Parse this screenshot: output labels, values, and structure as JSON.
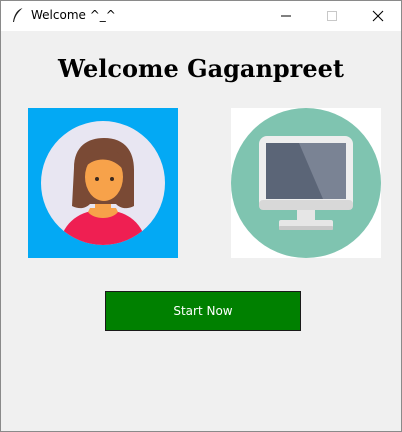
{
  "window": {
    "title": "Welcome ^_^",
    "app_icon": "feather-icon",
    "controls": {
      "minimize_icon": "minimize-icon",
      "maximize_icon": "maximize-icon",
      "close_icon": "close-icon"
    }
  },
  "main": {
    "heading": "Welcome Gaganpreet",
    "images": [
      {
        "icon": "user-avatar-icon",
        "background": "#03a9f4"
      },
      {
        "icon": "computer-monitor-icon",
        "background": "#7fc4b0"
      }
    ],
    "start_button": {
      "label": "Start Now",
      "color": "#008000"
    }
  },
  "colors": {
    "window_bg": "#f0f0f0",
    "titlebar_bg": "#ffffff"
  }
}
